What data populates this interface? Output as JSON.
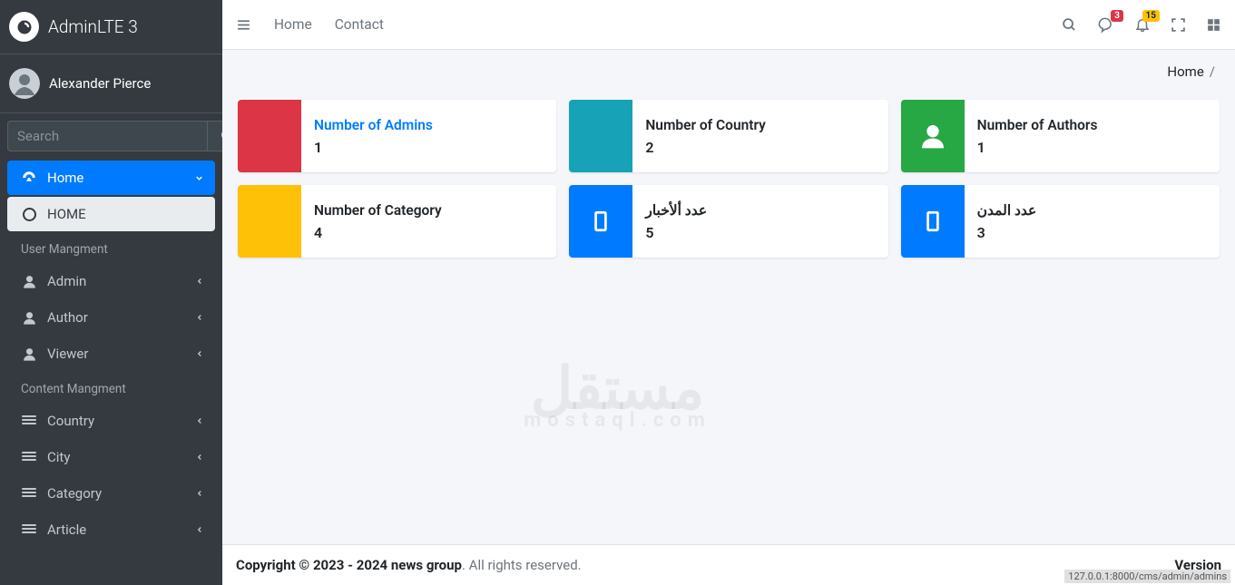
{
  "brand": "AdminLTE 3",
  "user": {
    "name": "Alexander Pierce"
  },
  "search": {
    "placeholder": "Search"
  },
  "sidebar": {
    "home": "Home",
    "home_sub": "HOME",
    "header_users": "User Mangment",
    "admin": "Admin",
    "author": "Author",
    "viewer": "Viewer",
    "header_content": "Content Mangment",
    "country": "Country",
    "city": "City",
    "category": "Category",
    "article": "Article"
  },
  "topnav": {
    "home": "Home",
    "contact": "Contact",
    "chat_badge": "3",
    "bell_badge": "15"
  },
  "breadcrumb": {
    "home": "Home",
    "sep": "/"
  },
  "boxes": {
    "b1": {
      "title": "Number of Admins",
      "value": "1"
    },
    "b2": {
      "title": "Number of Country",
      "value": "2"
    },
    "b3": {
      "title": "Number of Authors",
      "value": "1"
    },
    "b4": {
      "title": "Number of Category",
      "value": "4"
    },
    "b5": {
      "title": "عدد ألأخبار",
      "value": "5"
    },
    "b6": {
      "title": "عدد المدن",
      "value": "3"
    }
  },
  "footer": {
    "copyright_prefix": "Copyright © 2023 - 2024 ",
    "company": "news group",
    "suffix": ". All rights reserved.",
    "version_label": "Version"
  },
  "status_url": "127.0.0.1:8000/cms/admin/admins"
}
